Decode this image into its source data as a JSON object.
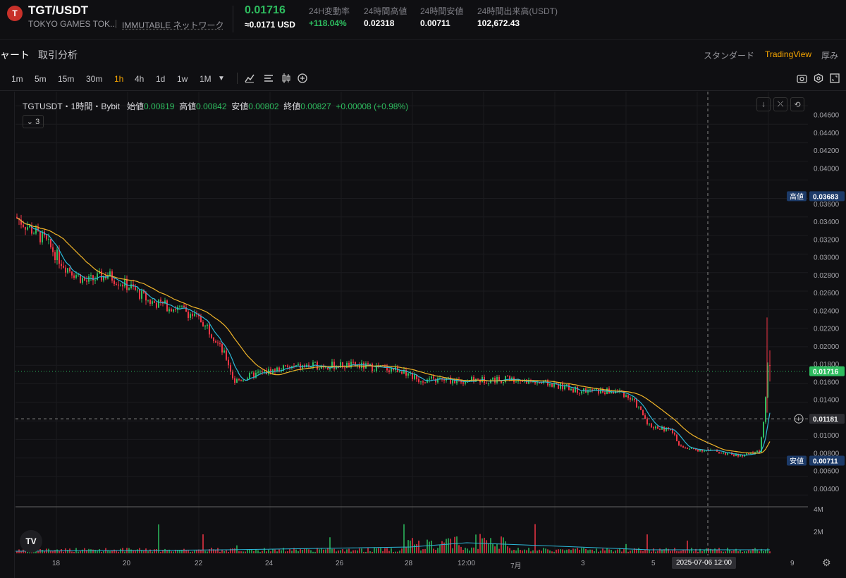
{
  "header": {
    "logo_text": "T",
    "pair": "TGT/USDT",
    "token_name": "TOKYO GAMES TOK...",
    "network": "IMMUTABLE ネットワーク",
    "price": "0.01716",
    "price_usd": "≈0.0171 USD",
    "stats": [
      {
        "label": "24H変動率",
        "value": "+118.04%",
        "color": "#2ebd5f"
      },
      {
        "label": "24時間高値",
        "value": "0.02318",
        "color": "#ffffff"
      },
      {
        "label": "24時間安値",
        "value": "0.00711",
        "color": "#ffffff"
      },
      {
        "label": "24時間出来高(USDT)",
        "value": "102,672.43",
        "color": "#ffffff"
      }
    ]
  },
  "tabs": {
    "chart": "ャート",
    "trade_analysis": "取引分析",
    "standard": "スタンダード",
    "tradingview": "TradingView",
    "depth": "厚み"
  },
  "toolbar": {
    "timeframes": [
      "1m",
      "5m",
      "15m",
      "30m",
      "1h",
      "4h",
      "1d",
      "1w",
      "1M"
    ],
    "active_timeframe": "1h",
    "icons": [
      "chevron-down-icon",
      "indicators-icon",
      "chart-type-icon",
      "candles-icon",
      "add-icon",
      "camera-icon",
      "settings-icon",
      "fullscreen-icon"
    ]
  },
  "legend": {
    "symbol": "TGTUSDT・1時間・Bybit",
    "open_label": "始値",
    "open": "0.00819",
    "high_label": "高値",
    "high": "0.00842",
    "low_label": "安値",
    "low": "0.00802",
    "close_label": "終値",
    "close": "0.00827",
    "change": "+0.00008 (+0.98%)",
    "indicator_count": "3"
  },
  "price_axis": {
    "ticks": [
      "0.04600",
      "0.04400",
      "0.04200",
      "0.04000",
      "0.03600",
      "0.03400",
      "0.03200",
      "0.03000",
      "0.02800",
      "0.02600",
      "0.02400",
      "0.02200",
      "0.02000",
      "0.01800",
      "0.01600",
      "0.01400",
      "0.01000",
      "0.00800",
      "0.00600",
      "0.00400"
    ],
    "high_label": "高値",
    "high_value": "0.03683",
    "current_value": "0.01716",
    "crosshair_value": "0.01181",
    "low_label": "安値",
    "low_value": "0.00711",
    "volume_ticks": [
      "4M",
      "2M"
    ]
  },
  "time_axis": {
    "ticks": [
      "18",
      "20",
      "22",
      "24",
      "26",
      "28",
      "12:00",
      "7月",
      "3",
      "5",
      "9"
    ],
    "crosshair_label": "2025-07-06   12:00"
  },
  "watermark": "TV",
  "colors": {
    "up": "#2ebd5f",
    "down": "#f23645",
    "ma_fast": "#2db8d9",
    "ma_slow": "#f0b429",
    "accent": "#f7a600"
  }
}
